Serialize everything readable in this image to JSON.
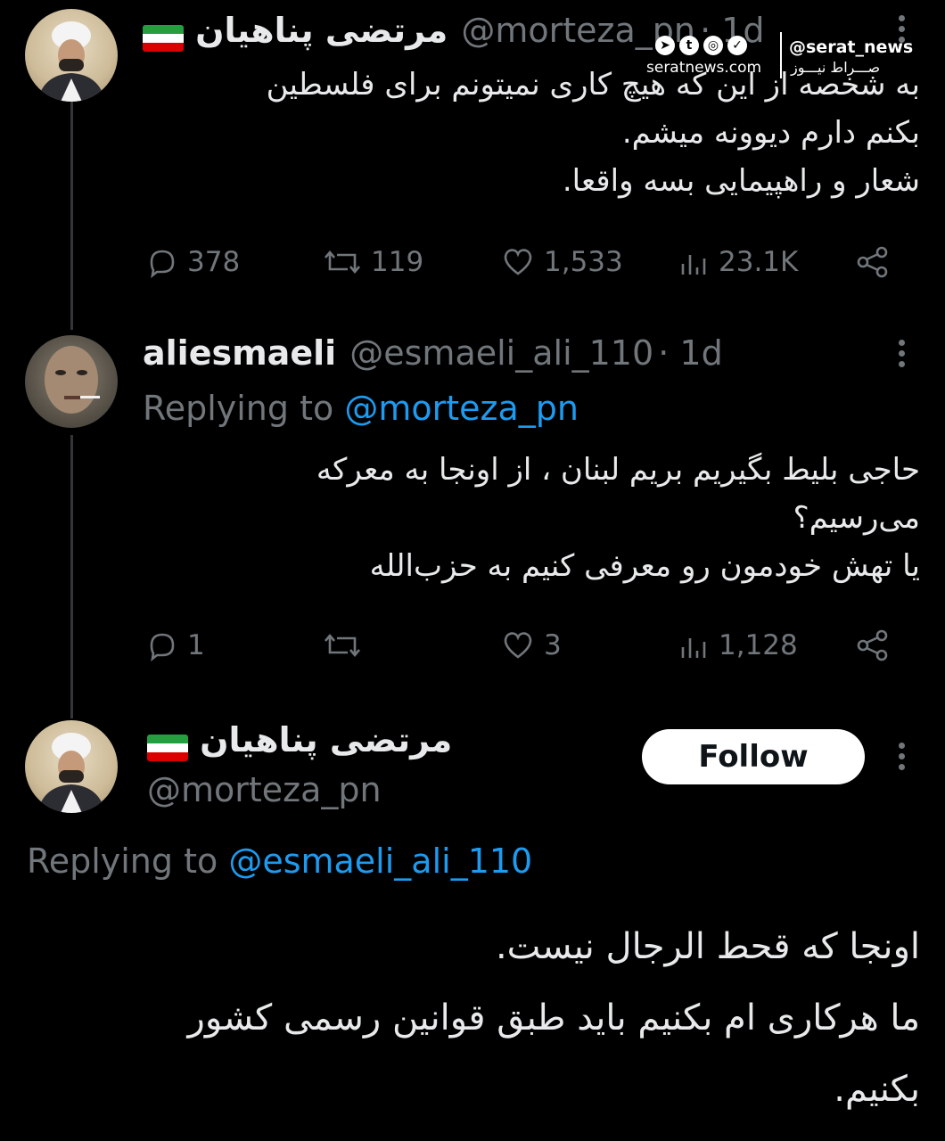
{
  "watermark": {
    "handle": "@serat_news",
    "site": "seratnews.com",
    "brand": "صـــراط نیـــوز",
    "icons": [
      "telegram-icon",
      "twitter-icon",
      "instagram-icon",
      "aparat-icon"
    ]
  },
  "tweets": [
    {
      "name": "مرتضی پناهیان",
      "handle": "@morteza_pn",
      "time": "· 1d",
      "body": [
        "به شخصه از این که هیچ کاری نمیتونم برای فلسطین",
        "بکنم دارم دیوونه میشم.",
        "شعار و راهپیمایی بسه واقعا."
      ],
      "replies": "378",
      "retweets": "119",
      "likes": "1,533",
      "views": "23.1K"
    },
    {
      "name": "aliesmaeli",
      "handle": "@esmaeli_ali_110",
      "time": "· 1d",
      "replying_prefix": "Replying to",
      "replying_to": "@morteza_pn",
      "body": [
        "حاجی بلیط بگیریم بریم لبنان ، از اونجا به معرکه",
        "می‌رسیم؟",
        "یا تهش خودمون رو معرفی کنیم به حزب‌الله"
      ],
      "replies": "1",
      "retweets": "",
      "likes": "3",
      "views": "1,128"
    },
    {
      "name": "مرتضی پناهیان",
      "handle": "@morteza_pn",
      "follow_label": "Follow",
      "replying_prefix": "Replying to",
      "replying_to": "@esmaeli_ali_110",
      "body": [
        "اونجا که قحط الرجال نیست.",
        "ما هرکاری ام بکنیم باید طبق قوانین رسمی کشور",
        "بکنیم."
      ]
    }
  ],
  "colors": {
    "background": "#000000",
    "link": "#1d9bf0",
    "muted": "#71767b",
    "text": "#e7e9ea"
  }
}
